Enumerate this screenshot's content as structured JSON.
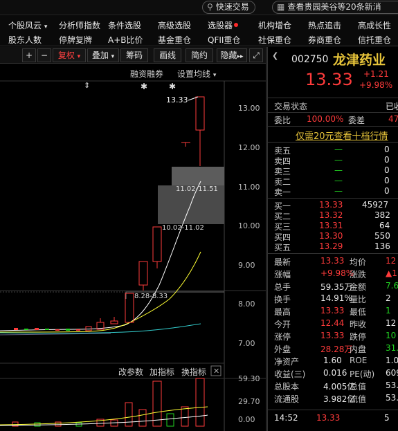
{
  "topbar": {
    "quick_trade": "快速交易",
    "news_ticker": "查看贵园美谷等20条新消"
  },
  "menu": {
    "row1": [
      "个股风云",
      "分析师指数",
      "条件选股",
      "高级选股",
      "选股器",
      "机构增仓",
      "热点追击",
      "高成长性"
    ],
    "row2": [
      "股东人数",
      "停牌复牌",
      "A+B比价",
      "基金重仓",
      "QFII重仓",
      "社保重仓",
      "券商重仓",
      "信托重仓"
    ]
  },
  "toolbar": {
    "plus": "+",
    "minus": "−",
    "fuquan": "复权",
    "overlay": "叠加",
    "chips": "筹码",
    "drawline": "画线",
    "simple": "简约",
    "hide": "隐藏"
  },
  "chart_header": {
    "margin": "融资融券",
    "set_ma": "设置均线"
  },
  "price_chart": {
    "y_ticks": [
      "13.00",
      "12.00",
      "11.00",
      "10.00",
      "9.00",
      "8.00",
      "7.00"
    ],
    "high_label": "13.33",
    "zone_labels": [
      "11.02-11.51",
      "10.02-11.02",
      "8.28-8.33"
    ]
  },
  "indicator_bar": {
    "change_params": "改参数",
    "add_indicator": "加指标",
    "switch_indicator": "换指标"
  },
  "volume_chart": {
    "y_ticks": [
      "59.30",
      "29.70",
      "0.00"
    ]
  },
  "quote": {
    "code": "002750",
    "name": "龙津药业",
    "price": "13.33",
    "change": "+1.21",
    "change_pct": "+9.98%",
    "trade_status_label": "交易状态",
    "trade_status_value": "已收",
    "weibi_label": "委比",
    "weibi_value": "100.00%",
    "weicha_label": "委差",
    "weicha_value": "47",
    "promo": "仅需20元查看十档行情",
    "asks": [
      {
        "label": "卖五",
        "price": "—",
        "vol": "0"
      },
      {
        "label": "卖四",
        "price": "—",
        "vol": "0"
      },
      {
        "label": "卖三",
        "price": "—",
        "vol": "0"
      },
      {
        "label": "卖二",
        "price": "—",
        "vol": "0"
      },
      {
        "label": "卖一",
        "price": "—",
        "vol": "0"
      }
    ],
    "bids": [
      {
        "label": "买一",
        "price": "13.33",
        "vol": "45927"
      },
      {
        "label": "买二",
        "price": "13.32",
        "vol": "382"
      },
      {
        "label": "买三",
        "price": "13.31",
        "vol": "64"
      },
      {
        "label": "买四",
        "price": "13.30",
        "vol": "550"
      },
      {
        "label": "买五",
        "price": "13.29",
        "vol": "136"
      }
    ],
    "stats": [
      {
        "l1": "最新",
        "v1": "13.33",
        "l2": "均价",
        "v2": "12"
      },
      {
        "l1": "涨幅",
        "v1": "+9.98%",
        "l2": "涨跌",
        "v2": "▲1"
      },
      {
        "l1": "总手",
        "v1": "59.35万",
        "l2": "金额",
        "v2": "7.6"
      },
      {
        "l1": "换手",
        "v1": "14.91%",
        "l2": "量比",
        "v2": "2"
      },
      {
        "l1": "最高",
        "v1": "13.33",
        "l2": "最低",
        "v2": "1"
      },
      {
        "l1": "今开",
        "v1": "12.44",
        "l2": "昨收",
        "v2": "12"
      },
      {
        "l1": "涨停",
        "v1": "13.33",
        "l2": "跌停",
        "v2": "10"
      },
      {
        "l1": "外盘",
        "v1": "28.28万",
        "l2": "内盘",
        "v2": "31.0"
      },
      {
        "l1": "净资产",
        "v1": "1.60",
        "l2": "ROE",
        "v2": "1.0"
      },
      {
        "l1": "收益(三)",
        "v1": "0.016",
        "l2": "PE(动)",
        "v2": "609"
      },
      {
        "l1": "总股本",
        "v1": "4.005亿",
        "l2": "总值",
        "v2": "53.3"
      },
      {
        "l1": "流通股",
        "v1": "3.982亿",
        "l2": "流值",
        "v2": "53.0"
      }
    ],
    "tick": {
      "time": "14:52",
      "price": "13.33",
      "vol": "5"
    }
  },
  "colors": {
    "up": "#ff3b3b",
    "down": "#22d422",
    "ma5": "#ffffff",
    "ma10": "#ffff33",
    "ma20": "#33cccc"
  }
}
